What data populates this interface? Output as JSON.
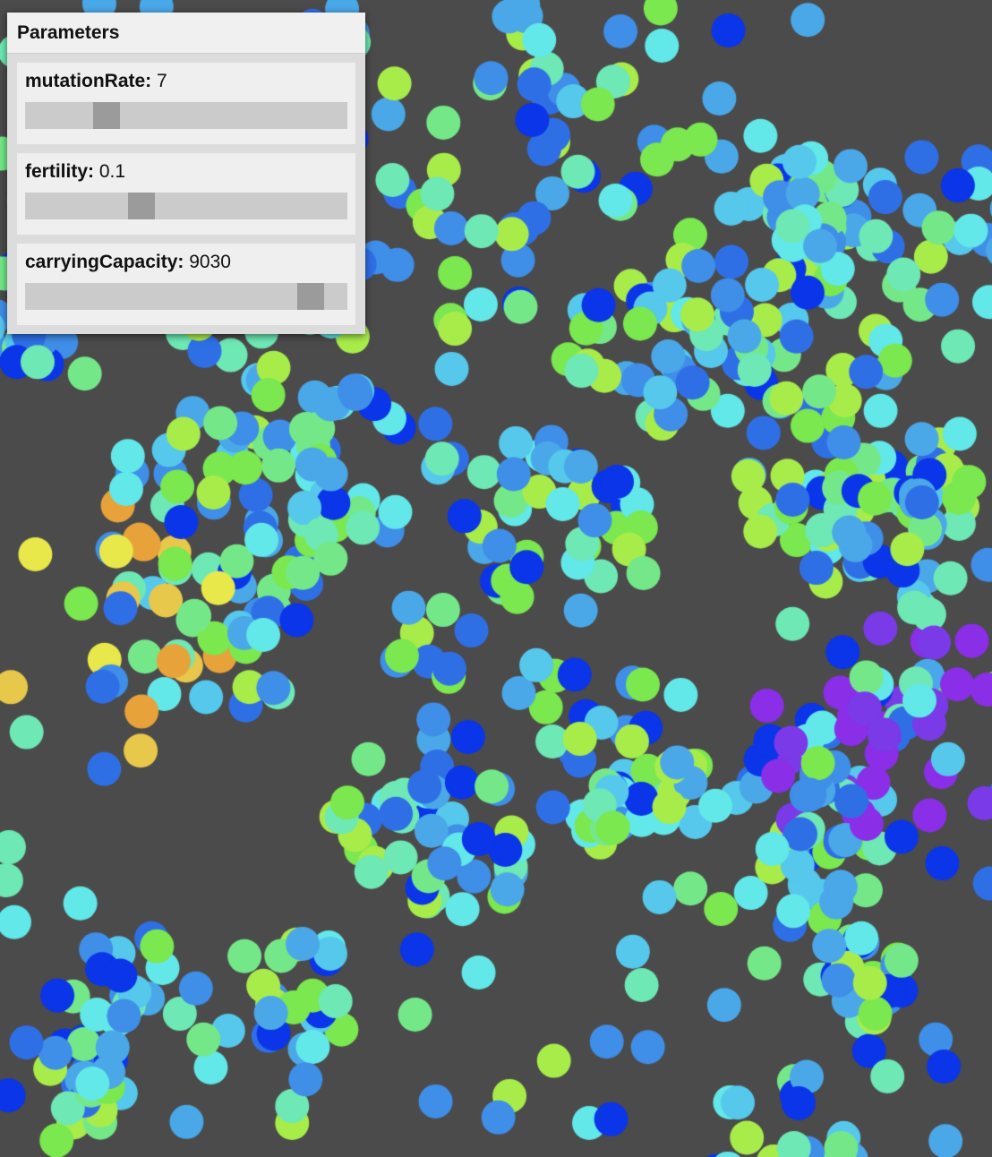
{
  "panel": {
    "title": "Parameters",
    "params": [
      {
        "name": "mutationRate:",
        "value": "7",
        "slider_fraction": 0.23
      },
      {
        "name": "fertility:",
        "value": "0.1",
        "slider_fraction": 0.35
      },
      {
        "name": "carryingCapacity:",
        "value": "9030",
        "slider_fraction": 0.92
      }
    ]
  },
  "canvas": {
    "background": "#4b4b4b",
    "dot_colors": [
      "#0a35e8",
      "#2f6fe6",
      "#3f8ee8",
      "#4aa8e8",
      "#55c8ec",
      "#62e8e8",
      "#6ee8b4",
      "#74e889",
      "#7ae84e",
      "#a8ec4a",
      "#e8e84a",
      "#e8c84a",
      "#e8a23a",
      "#7a3ae8",
      "#8a2ee8"
    ]
  }
}
